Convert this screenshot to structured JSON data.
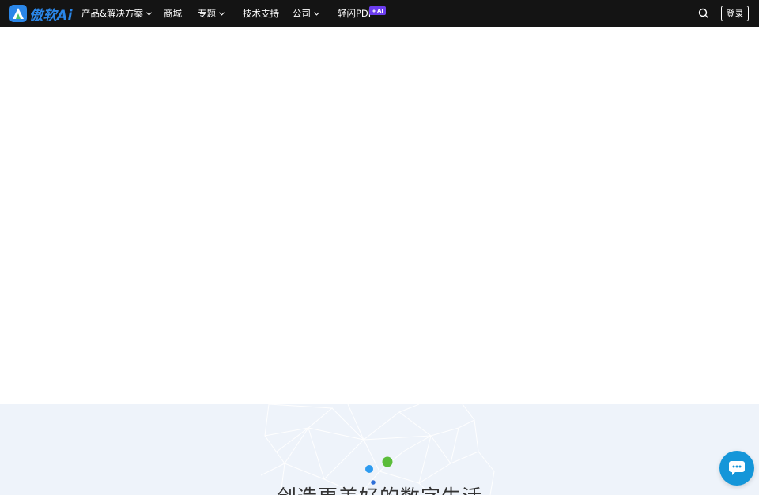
{
  "brand": {
    "name": "傲软Ai",
    "color": "#2a86e8"
  },
  "nav": {
    "items": [
      {
        "label": "产品&解决方案",
        "has_dropdown": true
      },
      {
        "label": "商城",
        "has_dropdown": false
      },
      {
        "label": "专题",
        "has_dropdown": true
      },
      {
        "label": "技术支持",
        "has_dropdown": false
      },
      {
        "label": "公司",
        "has_dropdown": true
      },
      {
        "label": "轻闪PDF",
        "has_dropdown": false
      }
    ],
    "ai_badge": "AI",
    "search_icon": "search-icon",
    "login_label": "登录"
  },
  "promo": {
    "slogan": "创造更美好的数字生活"
  },
  "chat": {
    "icon": "chat-bubble-icon",
    "color": "#1596d9"
  }
}
